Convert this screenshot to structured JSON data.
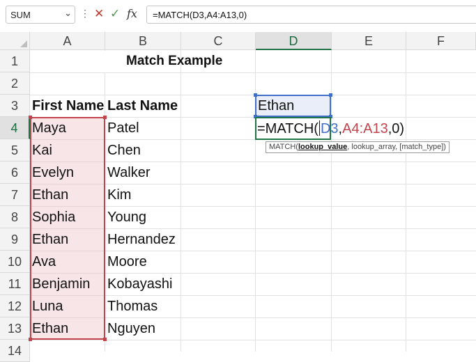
{
  "formula_bar": {
    "name_box": "SUM",
    "formula": "=MATCH(D3,A4:A13,0)",
    "fx_label": "fx"
  },
  "columns": [
    "A",
    "B",
    "C",
    "D",
    "E",
    "F"
  ],
  "rows": [
    "1",
    "2",
    "3",
    "4",
    "5",
    "6",
    "7",
    "8",
    "9",
    "10",
    "11",
    "12",
    "13",
    "14"
  ],
  "cells": {
    "title": "Match Example",
    "header_first": "First Name",
    "header_last": "Last Name",
    "lookup_value": "Ethan",
    "first_names": [
      "Maya",
      "Kai",
      "Evelyn",
      "Ethan",
      "Sophia",
      "Ethan",
      "Ava",
      "Benjamin",
      "Luna",
      "Ethan"
    ],
    "last_names": [
      "Patel",
      "Chen",
      "Walker",
      "Kim",
      "Young",
      "Hernandez",
      "Moore",
      "Kobayashi",
      "Thomas",
      "Nguyen"
    ]
  },
  "edit": {
    "prefix": "=MATCH(",
    "ref1": "D3",
    "comma1": ",",
    "ref2": "A4:A13",
    "suffix": ",0)"
  },
  "tooltip": {
    "fn": "MATCH(",
    "arg1": "lookup_value",
    "rest": ", lookup_array, [match_type])"
  },
  "colors": {
    "accent": "#217346",
    "ref_blue": "#3f6fc8",
    "ref_red": "#c1444d"
  }
}
